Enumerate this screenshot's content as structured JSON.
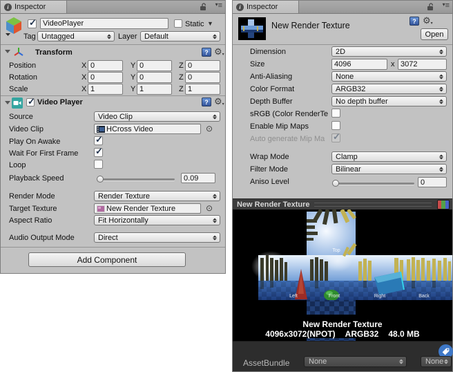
{
  "icons": {
    "info": "i",
    "menu": "≡",
    "caret": "▾",
    "gear": "⚙",
    "picker": "⊙",
    "help": "?",
    "static_caret": "▼"
  },
  "left_panel": {
    "tab_label": "Inspector",
    "header": {
      "name_value": "VideoPlayer",
      "static_label": "Static",
      "tag_label": "Tag",
      "tag_value": "Untagged",
      "layer_label": "Layer",
      "layer_value": "Default"
    },
    "transform": {
      "title": "Transform",
      "axis": {
        "x": "X",
        "y": "Y",
        "z": "Z"
      },
      "rows": [
        {
          "label": "Position",
          "x": "0",
          "y": "0",
          "z": "0"
        },
        {
          "label": "Rotation",
          "x": "0",
          "y": "0",
          "z": "0"
        },
        {
          "label": "Scale",
          "x": "1",
          "y": "1",
          "z": "1"
        }
      ]
    },
    "video_player": {
      "title": "Video Player",
      "source_label": "Source",
      "source_value": "Video Clip",
      "clip_label": "Video Clip",
      "clip_value": "HCross Video",
      "play_on_awake_label": "Play On Awake",
      "wait_label": "Wait For First Frame",
      "loop_label": "Loop",
      "speed_label": "Playback Speed",
      "speed_value": "0.09",
      "render_mode_label": "Render Mode",
      "render_mode_value": "Render Texture",
      "target_label": "Target Texture",
      "target_value": "New Render Texture",
      "aspect_label": "Aspect Ratio",
      "aspect_value": "Fit Horizontally",
      "audio_label": "Audio Output Mode",
      "audio_value": "Direct"
    },
    "add_component_label": "Add Component"
  },
  "right_panel": {
    "tab_label": "Inspector",
    "header": {
      "title": "New Render Texture",
      "open_label": "Open"
    },
    "settings": {
      "dimension_label": "Dimension",
      "dimension_value": "2D",
      "size_label": "Size",
      "size_w": "4096",
      "size_sep": "x",
      "size_h": "3072",
      "aa_label": "Anti-Aliasing",
      "aa_value": "None",
      "format_label": "Color Format",
      "format_value": "ARGB32",
      "depth_label": "Depth Buffer",
      "depth_value": "No depth buffer",
      "srgb_label": "sRGB (Color RenderTe",
      "mip_label": "Enable Mip Maps",
      "auto_mip_label": "Auto generate Mip Ma",
      "wrap_label": "Wrap Mode",
      "wrap_value": "Clamp",
      "filter_label": "Filter Mode",
      "filter_value": "Bilinear",
      "aniso_label": "Aniso Level",
      "aniso_value": "0"
    },
    "preview": {
      "title": "New Render Texture",
      "face_labels": {
        "top": "Top",
        "left": "Left",
        "front": "Front",
        "right": "Right",
        "back": "Back"
      },
      "info_name": "New Render Texture",
      "info_size": "4096x3072(NPOT)",
      "info_format": "ARGB32",
      "info_memory": "48.0 MB"
    },
    "assetbundle": {
      "label": "AssetBundle",
      "bundle_value": "None",
      "variant_value": "None"
    }
  },
  "colors": {
    "panel_bg": "#c2c2c2",
    "dark_bar": "#2d2d2d",
    "preview_header": "#3c3c3c",
    "tag_button": "#3e78c8",
    "help_blue": "#34549b",
    "check": "#20334e"
  }
}
